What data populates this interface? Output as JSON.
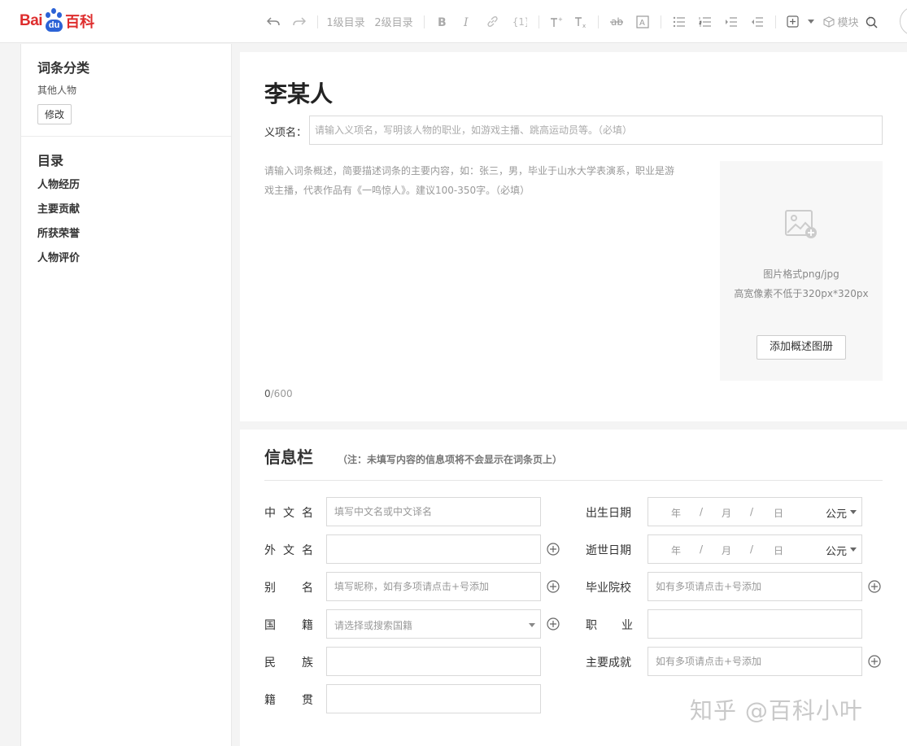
{
  "logo": {
    "bai": "Bai",
    "du": "du",
    "baike": "百科"
  },
  "toolbar": {
    "heading1": "1级目录",
    "heading2": "2级目录",
    "module": "模块"
  },
  "sidebar": {
    "category_title": "词条分类",
    "category_value": "其他人物",
    "edit_button": "修改",
    "toc_title": "目录",
    "toc_items": [
      "人物经历",
      "主要贡献",
      "所获荣誉",
      "人物评价"
    ]
  },
  "summary": {
    "title": "李某人",
    "meaning_label": "义项名：",
    "meaning_placeholder": "请输入义项名，写明该人物的职业，如游戏主播、跳高运动员等。（必填）",
    "summary_line1": "请输入词条概述，简要描述词条的主要内容，如：张三，男，毕业于山水大学表演系，职业是游",
    "summary_line2": "戏主播，代表作品有《一鸣惊人》。建议100-350字。（必填）",
    "count_current": "0",
    "count_max": "/600",
    "image_hint1": "图片格式png/jpg",
    "image_hint2": "高宽像素不低于320px*320px",
    "album_button": "添加概述图册"
  },
  "info": {
    "title": "信息栏",
    "note": "（注：未填写内容的信息项将不会显示在词条页上）",
    "chinese_name": {
      "label": "中文名",
      "placeholder": "填写中文名或中文译名"
    },
    "foreign_name": {
      "label": "外文名",
      "placeholder": ""
    },
    "alias": {
      "label": "别名",
      "placeholder": "填写昵称，如有多项请点击+号添加"
    },
    "nationality": {
      "label": "国籍",
      "placeholder": "请选择或搜索国籍"
    },
    "ethnicity": {
      "label": "民族",
      "placeholder": ""
    },
    "native_place": {
      "label": "籍贯",
      "placeholder": ""
    },
    "birth_date": {
      "label": "出生日期",
      "year": "年",
      "month": "月",
      "day": "日",
      "sep": "/",
      "era": "公元"
    },
    "death_date": {
      "label": "逝世日期",
      "year": "年",
      "month": "月",
      "day": "日",
      "sep": "/",
      "era": "公元"
    },
    "school": {
      "label": "毕业院校",
      "placeholder": "如有多项请点击+号添加"
    },
    "occupation": {
      "label": "职业",
      "placeholder": ""
    },
    "achievement": {
      "label": "主要成就",
      "placeholder": "如有多项请点击+号添加"
    }
  },
  "watermark": "知乎 @百科小叶",
  "colors": {
    "brand_red": "#de2d2d",
    "brand_blue": "#2b62d6"
  }
}
